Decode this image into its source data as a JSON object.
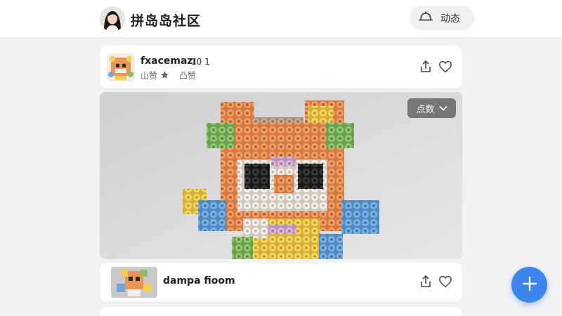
{
  "header": {
    "title": "拼岛岛社区",
    "activity_label": "动态"
  },
  "post1": {
    "username": "fxacemazı",
    "meta": "10 1",
    "sub_text_1": "山赞",
    "sub_text_2": "凸赞",
    "image_filter_label": "点数"
  },
  "post2": {
    "username": "dampa fioom"
  },
  "colors": {
    "accent": "#3d86f0",
    "topbar_bg": "#ffffff",
    "page_bg": "#f1f2f4",
    "bead_orange": "#e9965a",
    "bead_yellow": "#f2cf54",
    "bead_blue": "#6fa7da",
    "bead_green": "#8cc06a",
    "bead_black": "#2a2a2a"
  },
  "icons": [
    "user-avatar",
    "bell-icon",
    "share-icon",
    "heart-icon",
    "star-icon",
    "thumb-up-icon",
    "chevron-down-icon",
    "plus-icon"
  ]
}
